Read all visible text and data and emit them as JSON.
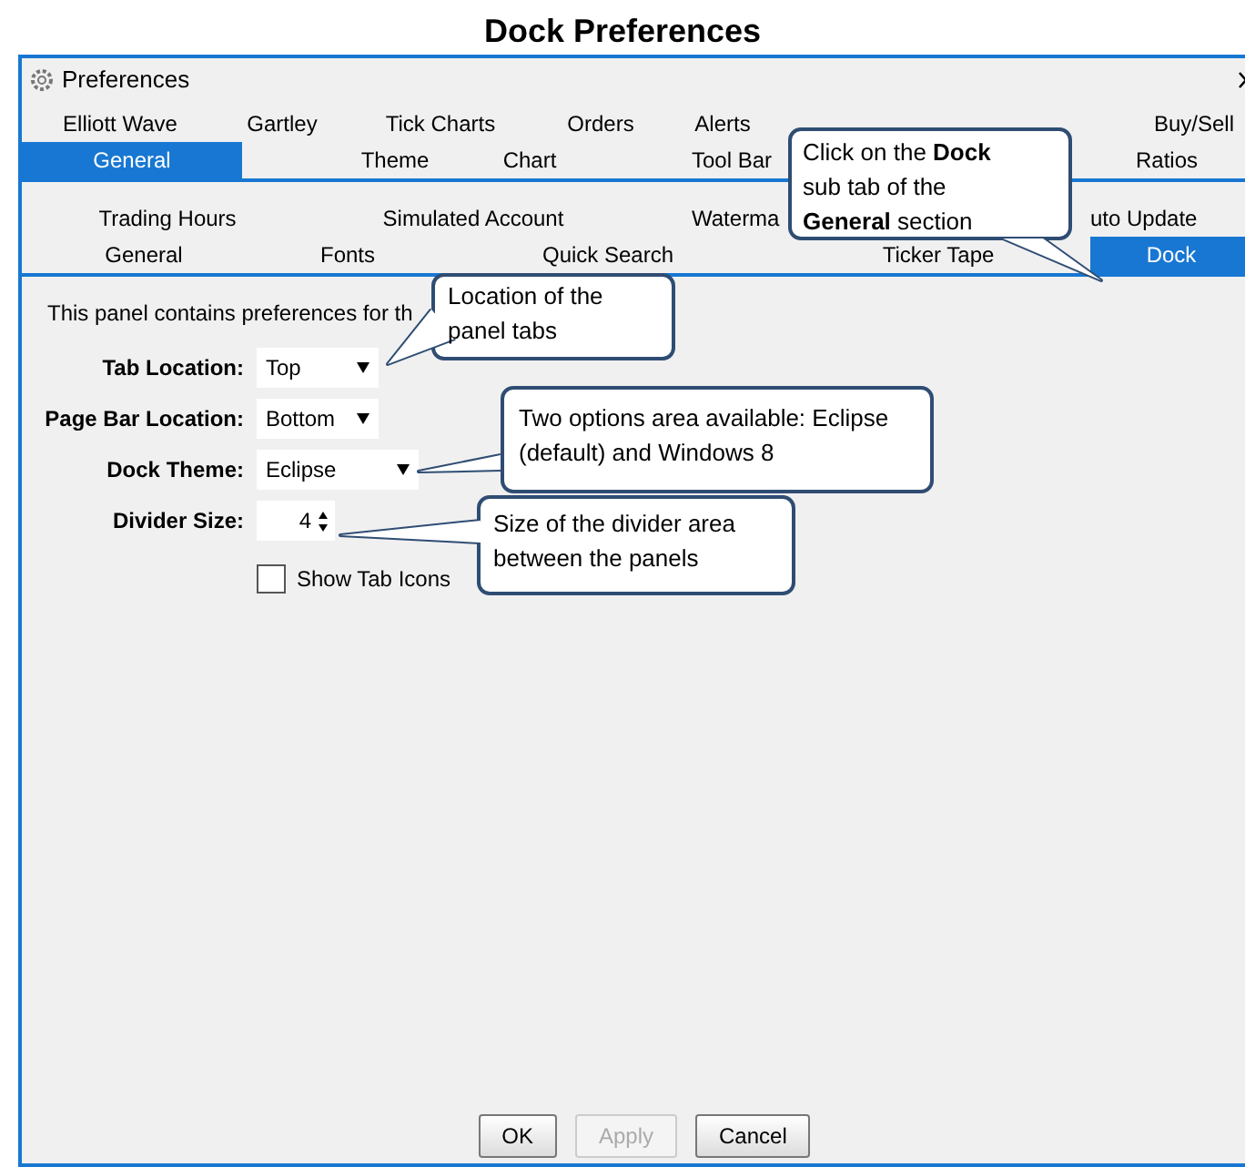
{
  "page_title": "Dock Preferences",
  "window": {
    "title": "Preferences"
  },
  "tabs": [
    [
      {
        "label": "Elliott Wave",
        "selected": false
      },
      {
        "label": "Gartley",
        "selected": false
      },
      {
        "label": "Tick Charts",
        "selected": false
      },
      {
        "label": "Orders",
        "selected": false
      },
      {
        "label": "Alerts",
        "selected": false
      },
      {
        "label": "Buy/Sell",
        "selected": false
      }
    ],
    [
      {
        "label": "General",
        "selected": true
      },
      {
        "label": "Theme",
        "selected": false
      },
      {
        "label": "Chart",
        "selected": false
      },
      {
        "label": "Tool Bar",
        "selected": false
      },
      {
        "label": "Ratios",
        "selected": false
      }
    ]
  ],
  "sub_tabs": [
    [
      {
        "label": "Trading Hours",
        "selected": false
      },
      {
        "label": "Simulated Account",
        "selected": false
      },
      {
        "label": "Waterma",
        "selected": false
      },
      {
        "label": "uto Update",
        "selected": false
      }
    ],
    [
      {
        "label": "General",
        "selected": false
      },
      {
        "label": "Fonts",
        "selected": false
      },
      {
        "label": "Quick Search",
        "selected": false
      },
      {
        "label": "Ticker Tape",
        "selected": false
      },
      {
        "label": "Dock",
        "selected": true
      }
    ]
  ],
  "panel": {
    "description": "This panel contains preferences for th",
    "fields": [
      {
        "kind": "dropdown",
        "label": "Tab Location:",
        "value": "Top"
      },
      {
        "kind": "dropdown",
        "label": "Page Bar Location:",
        "value": "Bottom"
      },
      {
        "kind": "dropdown",
        "label": "Dock Theme:",
        "value": "Eclipse"
      },
      {
        "kind": "spinner",
        "label": "Divider Size:",
        "value": "4"
      }
    ],
    "checkbox": {
      "label": "Show Tab Icons",
      "checked": false
    }
  },
  "buttons": [
    {
      "label": "OK",
      "disabled": false
    },
    {
      "label": "Apply",
      "disabled": true
    },
    {
      "label": "Cancel",
      "disabled": false
    }
  ],
  "callouts": [
    "Click on the **Dock** sub tab of the **General** section",
    "Location of the panel tabs",
    "Two options area available: Eclipse (default) and Windows 8",
    "Size of the divider area between the panels"
  ]
}
